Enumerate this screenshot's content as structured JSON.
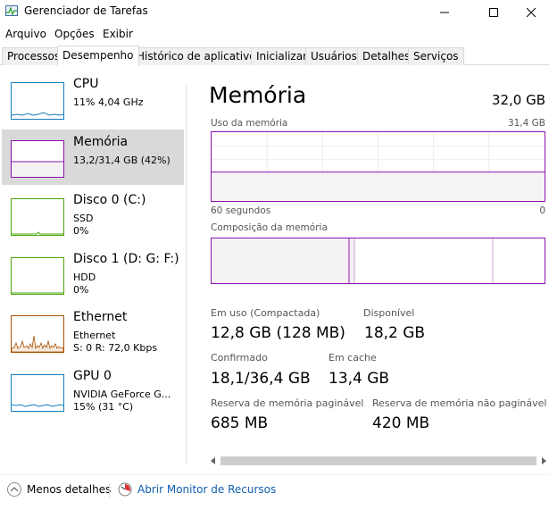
{
  "window": {
    "title": "Gerenciador de Tarefas"
  },
  "menu": [
    "Arquivo",
    "Opções",
    "Exibir"
  ],
  "tabs": [
    "Processos",
    "Desempenho",
    "Histórico de aplicativos",
    "Inicializar",
    "Usuários",
    "Detalhes",
    "Serviços"
  ],
  "active_tab": "Desempenho",
  "sidebar": [
    {
      "name": "CPU",
      "sub1": "11% 4,04 GHz",
      "sub2": "",
      "color": "#117dbb"
    },
    {
      "name": "Memória",
      "sub1": "13,2/31,4 GB (42%)",
      "sub2": "",
      "color": "#8b12ae"
    },
    {
      "name": "Disco 0 (C:)",
      "sub1": "SSD",
      "sub2": "0%",
      "color": "#4da60c"
    },
    {
      "name": "Disco 1 (D: G: F:)",
      "sub1": "HDD",
      "sub2": "0%",
      "color": "#4da60c"
    },
    {
      "name": "Ethernet",
      "sub1": "Ethernet",
      "sub2": "S: 0 R: 72,0 Kbps",
      "color": "#a74f01"
    },
    {
      "name": "GPU 0",
      "sub1": "NVIDIA GeForce G...",
      "sub2": "15% (31 °C)",
      "color": "#117dbb"
    }
  ],
  "selected_item": "Memória",
  "main": {
    "title": "Memória",
    "total": "32,0 GB",
    "usage_label": "Uso da memória",
    "usage_max": "31,4 GB",
    "time_left": "60 segundos",
    "time_right": "0",
    "usage_fraction": 0.42,
    "composition_label": "Composição da memória",
    "stats": {
      "in_use_label": "Em uso (Compactada)",
      "in_use_value": "12,8 GB (128 MB)",
      "available_label": "Disponível",
      "available_value": "18,2 GB",
      "committed_label": "Confirmado",
      "committed_value": "18,1/36,4 GB",
      "cached_label": "Em cache",
      "cached_value": "13,4 GB",
      "paged_label": "Reserva de memória paginável",
      "paged_value": "685 MB",
      "nonpaged_label": "Reserva de memória não paginável",
      "nonpaged_value": "420 MB"
    }
  },
  "footer": {
    "less_details": "Menos detalhes",
    "resource_monitor": "Abrir Monitor de Recursos"
  },
  "colors": {
    "memory": "#8b12ae",
    "memory_fill": "#f4f2f4",
    "accent_link": "#0f5fb0"
  }
}
